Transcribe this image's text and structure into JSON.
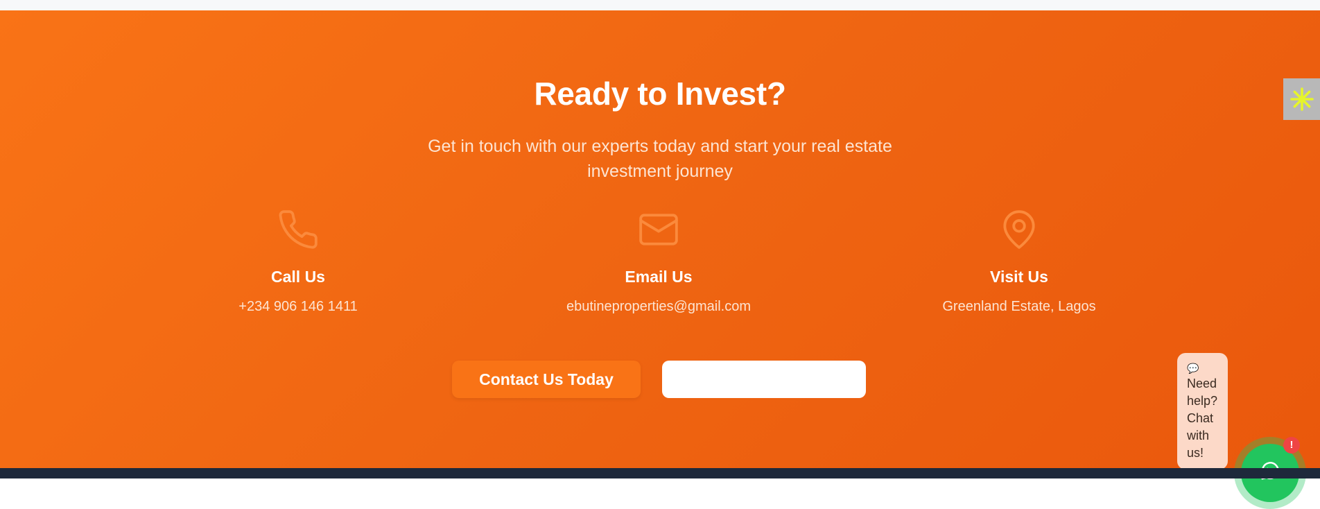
{
  "cta": {
    "title": "Ready to Invest?",
    "subtitle": "Get in touch with our experts today and start your real estate investment journey",
    "contacts": [
      {
        "icon": "phone-icon",
        "label": "Call Us",
        "value": "+234 906 146 1411"
      },
      {
        "icon": "mail-icon",
        "label": "Email Us",
        "value": "ebutineproperties@gmail.com"
      },
      {
        "icon": "map-pin-icon",
        "label": "Visit Us",
        "value": "Greenland Estate, Lagos"
      }
    ],
    "primary_button": "Contact Us Today",
    "secondary_button": ""
  },
  "chat": {
    "emoji": "💬",
    "lines": [
      "Need",
      "help?",
      "Chat",
      "with",
      "us!"
    ],
    "badge": "!"
  },
  "colors": {
    "accent": "#f97316",
    "accent_dark": "#ea580c",
    "whatsapp": "#22c55e",
    "badge": "#ef4444",
    "footer": "#1e293b"
  }
}
